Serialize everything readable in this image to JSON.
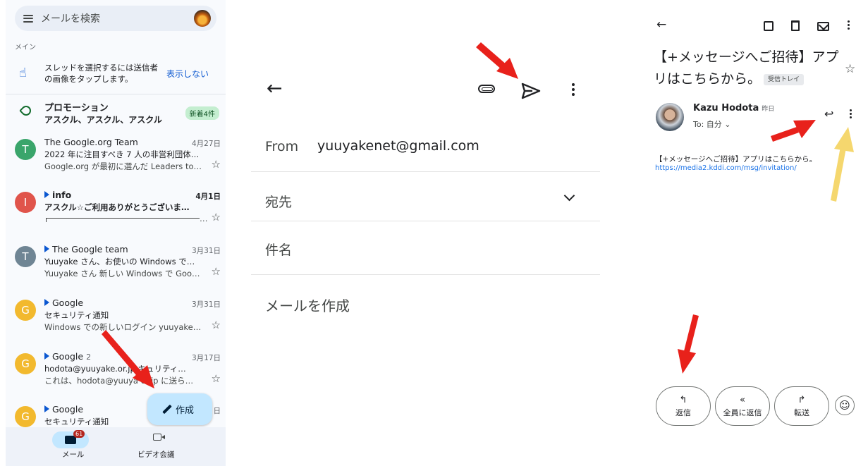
{
  "inbox": {
    "search_placeholder": "メールを検索",
    "section_label": "メイン",
    "tip": {
      "text": "スレッドを選択するには送信者の画像をタップします。",
      "action": "表示しない"
    },
    "promotions": {
      "title": "プロモーション",
      "senders": "アスクル、アスクル、アスクル",
      "badge": "新着4件"
    },
    "mails": [
      {
        "initial": "T",
        "color": "#3aa56b",
        "sender": "The Google.org Team",
        "count": "",
        "date": "4月27日",
        "subject": "2022 年に注目すべき 7 人の非営利団体…",
        "snippet": "Google.org が最初に選んだ Leaders to…",
        "unread": false
      },
      {
        "initial": "I",
        "color": "#e0544b",
        "sender": "info",
        "count": "",
        "date": "4月1日",
        "subject": "アスクル☆ご利用ありがとうございま…",
        "snippet": "…",
        "unread": true
      },
      {
        "initial": "T",
        "color": "#6f8594",
        "sender": "The Google team",
        "count": "",
        "date": "3月31日",
        "subject": "Yuuyake さん、お使いの Windows で…",
        "snippet": "Yuuyake さん 新しい Windows で Goo…",
        "unread": false
      },
      {
        "initial": "G",
        "color": "#f2b92e",
        "sender": "Google",
        "count": "",
        "date": "3月31日",
        "subject": "セキュリティ通知",
        "snippet": "Windows での新しいログイン yuuyake…",
        "unread": false
      },
      {
        "initial": "G",
        "color": "#f2b92e",
        "sender": "Google",
        "count": "2",
        "date": "3月17日",
        "subject": "hodota@yuuyake.or.jp キュリティ…",
        "snippet": "これは、hodota@yuuya or.jp に送ら…",
        "unread": false
      },
      {
        "initial": "G",
        "color": "#f2b92e",
        "sender": "Google",
        "count": "",
        "date": "日",
        "subject": "セキュリティ通知",
        "snippet": "",
        "unread": false
      }
    ],
    "compose_label": "作成",
    "nav": {
      "mail_label": "メール",
      "mail_badge": "61",
      "meet_label": "ビデオ会議"
    }
  },
  "compose": {
    "from_label": "From",
    "from_value": "yuuyakenet@gmail.com",
    "to_label": "宛先",
    "subject_label": "件名",
    "body_placeholder": "メールを作成"
  },
  "message": {
    "title": "【+メッセージへご招待】アプリはこちらから。",
    "label_chip": "受信トレイ",
    "sender_name": "Kazu Hodota",
    "sender_date": "昨日",
    "to_line": "To: 自分",
    "body": "【+メッセージへご招待】アプリはこちらから。",
    "link": "https://media2.kddi.com/msg/invitation/",
    "actions": {
      "reply": "返信",
      "reply_all": "全員に返信",
      "forward": "転送"
    }
  },
  "colors": {
    "accent_blue": "#0b57d0",
    "fab_bg": "#c2e7ff",
    "annotation_red": "#e8211b",
    "annotation_yellow": "#f5d76e"
  }
}
